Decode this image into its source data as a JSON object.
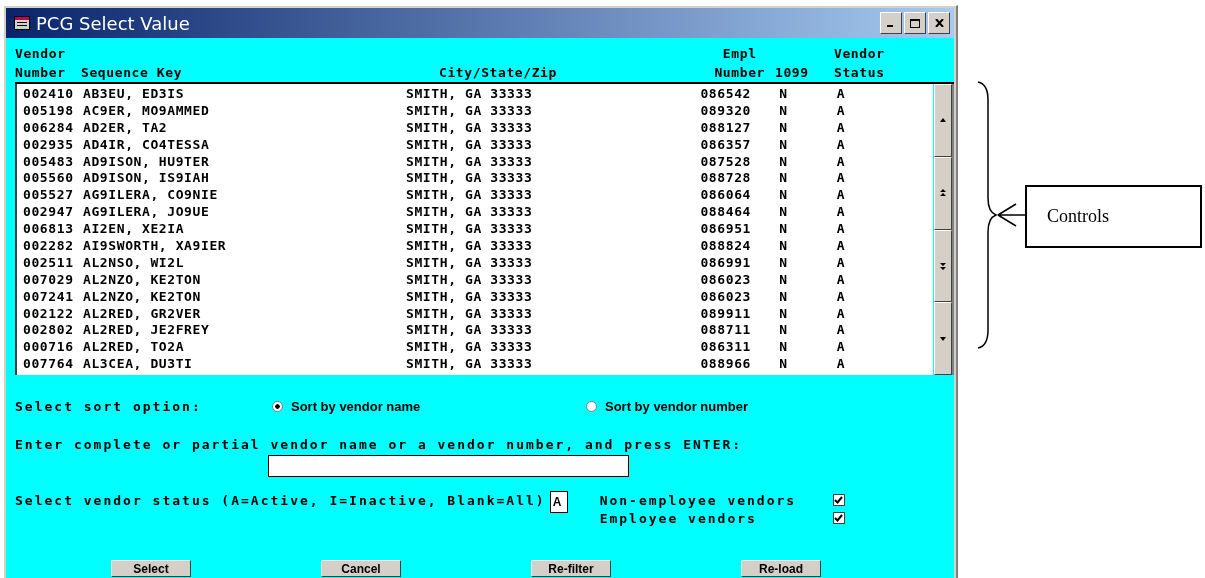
{
  "window": {
    "title": "PCG Select Value"
  },
  "table": {
    "columns": [
      "Vendor\nNumber",
      "Sequence Key",
      "City/State/Zip",
      "Empl\nNumber",
      "1099",
      "Vendor\nStatus"
    ],
    "rows": [
      {
        "number": "002410",
        "sequence_key": "AB3EU, ED3IS",
        "city": "SMITH, GA 33333",
        "empl_number": "086542",
        "form_1099": "N",
        "status": "A"
      },
      {
        "number": "005198",
        "sequence_key": "AC9ER, MO9AMMED",
        "city": "SMITH, GA 33333",
        "empl_number": "089320",
        "form_1099": "N",
        "status": "A"
      },
      {
        "number": "006284",
        "sequence_key": "AD2ER, TA2",
        "city": "SMITH, GA 33333",
        "empl_number": "088127",
        "form_1099": "N",
        "status": "A"
      },
      {
        "number": "002935",
        "sequence_key": "AD4IR, CO4TESSA",
        "city": "SMITH, GA 33333",
        "empl_number": "086357",
        "form_1099": "N",
        "status": "A"
      },
      {
        "number": "005483",
        "sequence_key": "AD9ISON, HU9TER",
        "city": "SMITH, GA 33333",
        "empl_number": "087528",
        "form_1099": "N",
        "status": "A"
      },
      {
        "number": "005560",
        "sequence_key": "AD9ISON, IS9IAH",
        "city": "SMITH, GA 33333",
        "empl_number": "088728",
        "form_1099": "N",
        "status": "A"
      },
      {
        "number": "005527",
        "sequence_key": "AG9ILERA, CO9NIE",
        "city": "SMITH, GA 33333",
        "empl_number": "086064",
        "form_1099": "N",
        "status": "A"
      },
      {
        "number": "002947",
        "sequence_key": "AG9ILERA, JO9UE",
        "city": "SMITH, GA 33333",
        "empl_number": "088464",
        "form_1099": "N",
        "status": "A"
      },
      {
        "number": "006813",
        "sequence_key": "AI2EN, XE2IA",
        "city": "SMITH, GA 33333",
        "empl_number": "086951",
        "form_1099": "N",
        "status": "A"
      },
      {
        "number": "002282",
        "sequence_key": "AI9SWORTH, XA9IER",
        "city": "SMITH, GA 33333",
        "empl_number": "088824",
        "form_1099": "N",
        "status": "A"
      },
      {
        "number": "002511",
        "sequence_key": "AL2NSO, WI2L",
        "city": "SMITH, GA 33333",
        "empl_number": "086991",
        "form_1099": "N",
        "status": "A"
      },
      {
        "number": "007029",
        "sequence_key": "AL2NZO, KE2TON",
        "city": "SMITH, GA 33333",
        "empl_number": "086023",
        "form_1099": "N",
        "status": "A"
      },
      {
        "number": "007241",
        "sequence_key": "AL2NZO, KE2TON",
        "city": "SMITH, GA 33333",
        "empl_number": "086023",
        "form_1099": "N",
        "status": "A"
      },
      {
        "number": "002122",
        "sequence_key": "AL2RED, GR2VER",
        "city": "SMITH, GA 33333",
        "empl_number": "089911",
        "form_1099": "N",
        "status": "A"
      },
      {
        "number": "002802",
        "sequence_key": "AL2RED, JE2FREY",
        "city": "SMITH, GA 33333",
        "empl_number": "088711",
        "form_1099": "N",
        "status": "A"
      },
      {
        "number": "000716",
        "sequence_key": "AL2RED, TO2A",
        "city": "SMITH, GA 33333",
        "empl_number": "086311",
        "form_1099": "N",
        "status": "A"
      },
      {
        "number": "007764",
        "sequence_key": "AL3CEA, DU3TI",
        "city": "SMITH, GA 33333",
        "empl_number": "088966",
        "form_1099": "N",
        "status": "A"
      }
    ]
  },
  "sort": {
    "label": "Select sort option:",
    "options": [
      {
        "label": "Sort by vendor name",
        "selected": true
      },
      {
        "label": "Sort by vendor number",
        "selected": false
      }
    ]
  },
  "search": {
    "label": "Enter complete or partial vendor name or a vendor number, and press ENTER:"
  },
  "status_filter": {
    "label": "Select vendor status (A=Active, I=Inactive, Blank=All)",
    "value": "A"
  },
  "checkboxes": [
    {
      "label": "Non-employee vendors",
      "checked": true
    },
    {
      "label": "Employee vendors",
      "checked": true
    }
  ],
  "buttons": [
    "Select",
    "Cancel",
    "Re-filter",
    "Re-load"
  ],
  "annotation": {
    "label": "Controls"
  }
}
